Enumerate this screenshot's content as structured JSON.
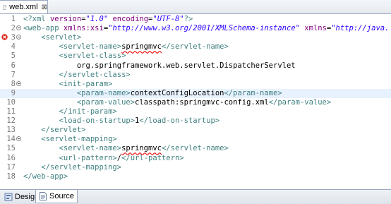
{
  "tab": {
    "filename": "web.xml",
    "close_glyph": "⊠",
    "icon": "xml-file-icon"
  },
  "bottom_tabs": [
    {
      "label": "Design",
      "icon": "design-icon"
    },
    {
      "label": "Source",
      "icon": "source-icon"
    }
  ],
  "colors": {
    "tag": "#3f7f7f",
    "attribute": "#7f007f",
    "value": "#2a00ff",
    "highlight": "#e8f2fe"
  },
  "lines": [
    {
      "n": "1",
      "parts": [
        [
          "tag",
          "<?xml "
        ],
        [
          "attr",
          "version"
        ],
        [
          "txt",
          "="
        ],
        [
          "val",
          "\"1.0\""
        ],
        [
          "txt",
          " "
        ],
        [
          "attr",
          "encoding"
        ],
        [
          "txt",
          "="
        ],
        [
          "val",
          "\"UTF-8\""
        ],
        [
          "tag",
          "?>"
        ]
      ]
    },
    {
      "n": "2",
      "parts": [
        [
          "tag",
          "<web-app "
        ],
        [
          "attr",
          "xmlns:xsi"
        ],
        [
          "txt",
          "="
        ],
        [
          "val",
          "\"http://www.w3.org/2001/XMLSchema-instance\""
        ],
        [
          "txt",
          " "
        ],
        [
          "attr",
          "xmlns"
        ],
        [
          "txt",
          "="
        ],
        [
          "val",
          "\"http://java."
        ]
      ]
    },
    {
      "n": "3",
      "parts": [
        [
          "tag",
          "    <servlet>"
        ]
      ]
    },
    {
      "n": "4",
      "parts": [
        [
          "tag",
          "        <servlet-name>"
        ],
        [
          "err",
          "springmvc"
        ],
        [
          "tag",
          "</servlet-name>"
        ]
      ]
    },
    {
      "n": "5",
      "parts": [
        [
          "tag",
          "        <servlet-class>"
        ]
      ]
    },
    {
      "n": "6",
      "parts": [
        [
          "txt",
          "            org.springframework.web.servlet.DispatcherServlet"
        ]
      ]
    },
    {
      "n": "7",
      "parts": [
        [
          "tag",
          "        </servlet-class>"
        ]
      ]
    },
    {
      "n": "8",
      "parts": [
        [
          "tag",
          "        <init-param>"
        ]
      ]
    },
    {
      "n": "9",
      "parts": [
        [
          "tag",
          "            <param-name>"
        ],
        [
          "txt",
          "contextConfigLocation"
        ],
        [
          "tag",
          "</param-name>"
        ]
      ]
    },
    {
      "n": "10",
      "parts": [
        [
          "tag",
          "            <param-value>"
        ],
        [
          "txt",
          "classpath:springmvc-config.xml"
        ],
        [
          "tag",
          "</param-value>"
        ]
      ]
    },
    {
      "n": "11",
      "parts": [
        [
          "tag",
          "        </init-param>"
        ]
      ]
    },
    {
      "n": "12",
      "parts": [
        [
          "tag",
          "        <load-on-startup>"
        ],
        [
          "txt",
          "1"
        ],
        [
          "tag",
          "</load-on-startup>"
        ]
      ]
    },
    {
      "n": "13",
      "parts": [
        [
          "tag",
          "    </servlet>"
        ]
      ]
    },
    {
      "n": "14",
      "parts": [
        [
          "tag",
          "    <servlet-mapping>"
        ]
      ]
    },
    {
      "n": "15",
      "parts": [
        [
          "tag",
          "        <servlet-name>"
        ],
        [
          "err",
          "springmvc"
        ],
        [
          "tag",
          "</servlet-name>"
        ]
      ]
    },
    {
      "n": "16",
      "parts": [
        [
          "tag",
          "        <url-pattern>"
        ],
        [
          "txt",
          "/"
        ],
        [
          "tag",
          "</url-pattern>"
        ]
      ]
    },
    {
      "n": "17",
      "parts": [
        [
          "tag",
          "    </servlet-mapping>"
        ]
      ]
    },
    {
      "n": "18",
      "parts": [
        [
          "tag",
          "</web-app>"
        ]
      ]
    }
  ],
  "folds": [
    "2",
    "3",
    "8",
    "14"
  ],
  "error_line": "3",
  "highlighted_line": "9"
}
